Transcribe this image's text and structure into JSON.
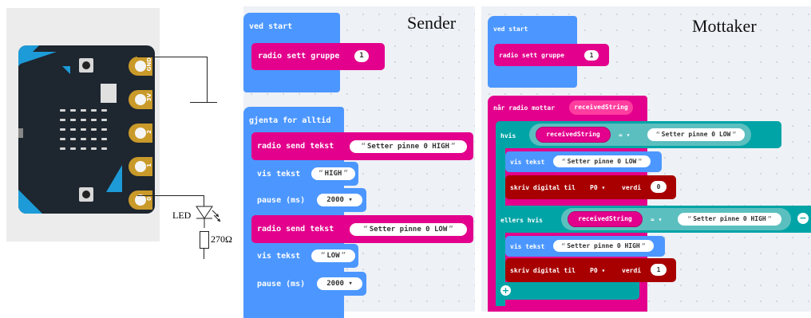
{
  "board": {
    "pins": [
      "GND",
      "3V",
      "2",
      "1",
      "0"
    ]
  },
  "circuit": {
    "led_label": "LED",
    "resistor_label": "270Ω"
  },
  "sender": {
    "title": "Sender",
    "on_start": {
      "label": "ved start",
      "set_group_label": "radio sett gruppe",
      "group_value": "1"
    },
    "forever": {
      "label": "gjenta for alltid",
      "send1_label": "radio send tekst",
      "send1_value": "Setter pinne 0 HIGH",
      "show1_label": "vis tekst",
      "show1_value": "HIGH",
      "pause1_label": "pause (ms)",
      "pause1_value": "2000",
      "send2_label": "radio send tekst",
      "send2_value": "Setter pinne 0 LOW",
      "show2_label": "vis tekst",
      "show2_value": "LOW",
      "pause2_label": "pause (ms)",
      "pause2_value": "2000"
    }
  },
  "receiver": {
    "title": "Mottaker",
    "on_start": {
      "label": "ved start",
      "set_group_label": "radio sett gruppe",
      "group_value": "1"
    },
    "on_received": {
      "label": "når radio mottar",
      "var": "receivedString",
      "if_label": "hvis",
      "if_var": "receivedString",
      "if_op": "= ▾",
      "if_value": "Setter pinne 0 LOW",
      "show1_label": "vis tekst",
      "show1_value": "Setter pinne 0 LOW",
      "write1_label": "skriv digital til",
      "write1_pin": "P0 ▾",
      "write1_value_label": "verdi",
      "write1_value": "0",
      "elseif_label": "ellers hvis",
      "elseif_var": "receivedString",
      "elseif_op": "= ▾",
      "elseif_value": "Setter pinne 0 HIGH",
      "show2_label": "vis tekst",
      "show2_value": "Setter pinne 0 HIGH",
      "write2_label": "skriv digital til",
      "write2_pin": "P0 ▾",
      "write2_value_label": "verdi",
      "write2_value": "1"
    }
  },
  "colors": {
    "basic": "#4c97ff",
    "radio": "#e3008c",
    "logic": "#00a4a6",
    "pins": "#a80000"
  }
}
